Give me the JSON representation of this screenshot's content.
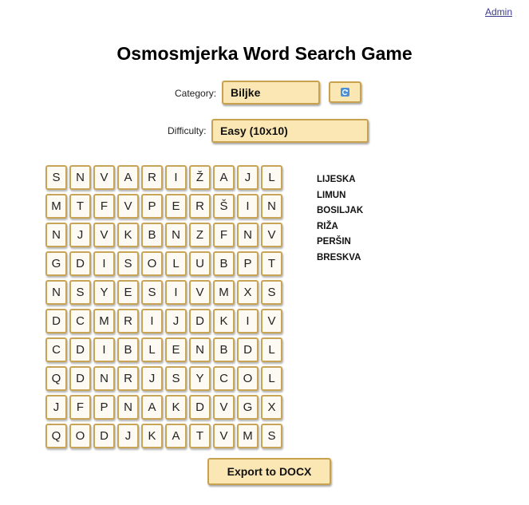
{
  "header": {
    "admin_link": "Admin",
    "title": "Osmosmjerka Word Search Game"
  },
  "controls": {
    "category_label": "Category:",
    "category_value": "Biljke",
    "difficulty_label": "Difficulty:",
    "difficulty_value": "Easy (10x10)",
    "refresh_icon": "refresh-icon",
    "accent_color": "#4a90d9"
  },
  "grid": [
    [
      "S",
      "N",
      "V",
      "A",
      "R",
      "I",
      "Ž",
      "A",
      "J",
      "L"
    ],
    [
      "M",
      "T",
      "F",
      "V",
      "P",
      "E",
      "R",
      "Š",
      "I",
      "N"
    ],
    [
      "N",
      "J",
      "V",
      "K",
      "B",
      "N",
      "Z",
      "F",
      "N",
      "V"
    ],
    [
      "G",
      "D",
      "I",
      "S",
      "O",
      "L",
      "U",
      "B",
      "P",
      "T"
    ],
    [
      "N",
      "S",
      "Y",
      "E",
      "S",
      "I",
      "V",
      "M",
      "X",
      "S"
    ],
    [
      "D",
      "C",
      "M",
      "R",
      "I",
      "J",
      "D",
      "K",
      "I",
      "V"
    ],
    [
      "C",
      "D",
      "I",
      "B",
      "L",
      "E",
      "N",
      "B",
      "D",
      "L"
    ],
    [
      "Q",
      "D",
      "N",
      "R",
      "J",
      "S",
      "Y",
      "C",
      "O",
      "L"
    ],
    [
      "J",
      "F",
      "P",
      "N",
      "A",
      "K",
      "D",
      "V",
      "G",
      "X"
    ],
    [
      "Q",
      "O",
      "D",
      "J",
      "K",
      "A",
      "T",
      "V",
      "M",
      "S"
    ]
  ],
  "words": [
    "LIJESKA",
    "LIMUN",
    "BOSILJAK",
    "RIŽA",
    "PERŠIN",
    "BRESKVA"
  ],
  "export_label": "Export to DOCX",
  "colors": {
    "tile_bg": "#fdfaf3",
    "tile_border": "#c8a457",
    "button_bg": "#fbe7b4"
  }
}
